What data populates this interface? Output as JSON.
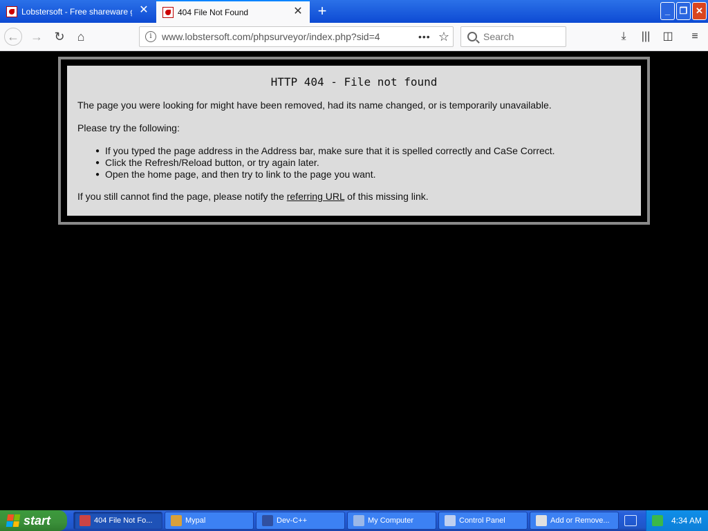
{
  "browser": {
    "tabs": [
      {
        "title": "Lobstersoft - Free shareware gam",
        "active": false
      },
      {
        "title": "404 File Not Found",
        "active": true
      }
    ],
    "url": "www.lobstersoft.com/phpsurveyor/index.php?sid=4",
    "search_placeholder": "Search"
  },
  "error": {
    "title": "HTTP 404 - File not found",
    "intro": "The page you were looking for might have been removed, had its name changed, or is temporarily unavailable.",
    "try_heading": "Please try the following:",
    "suggestions": [
      "If you typed the page address in the Address bar, make sure that it is spelled correctly and CaSe Correct.",
      "Click the Refresh/Reload button, or try again later.",
      "Open the home page, and then try to link to the page you want."
    ],
    "footer_before": "If you still cannot find the page, please notify the ",
    "footer_link": "referring URL",
    "footer_after": " of this missing link."
  },
  "taskbar": {
    "start_label": "start",
    "tasks": [
      {
        "label": "404 File Not Fo...",
        "active": true,
        "icon_color": "#c44"
      },
      {
        "label": "Mypal",
        "active": false,
        "icon_color": "#d8a03a"
      },
      {
        "label": "Dev-C++",
        "active": false,
        "icon_color": "#3050a0"
      },
      {
        "label": "My Computer",
        "active": false,
        "icon_color": "#9bb8e8"
      },
      {
        "label": "Control Panel",
        "active": false,
        "icon_color": "#c0d0f0"
      },
      {
        "label": "Add or Remove...",
        "active": false,
        "icon_color": "#e0e0e0"
      }
    ],
    "clock": "4:34 AM"
  }
}
